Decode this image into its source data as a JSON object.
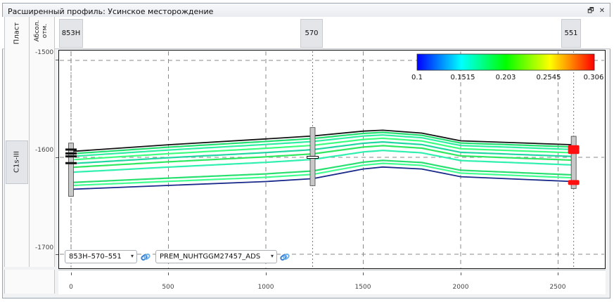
{
  "window": {
    "title": "Расширенный профиль: Усинское месторождение",
    "restore_icon": "restore-window-icon",
    "close_icon": "close-icon",
    "restore_glyph": "🗗",
    "close_glyph": "✕"
  },
  "columns": {
    "plast": "Пласт",
    "abs_line1": "Абсол.",
    "abs_line2": "отм."
  },
  "wells": [
    {
      "name": "853Н"
    },
    {
      "name": "570"
    },
    {
      "name": "551"
    }
  ],
  "layer": {
    "name": "C1s-III"
  },
  "y_axis": {
    "ticks": [
      "-1500",
      "-1600",
      "-1700"
    ]
  },
  "x_axis": {
    "ticks": [
      "0",
      "500",
      "1000",
      "1500",
      "2000",
      "2500"
    ]
  },
  "legend": {
    "labels": [
      "0.1",
      "0.1515",
      "0.203",
      "0.2545",
      "0.306"
    ],
    "colors": [
      "#0000ff",
      "#00ffff",
      "#00ff00",
      "#ffff00",
      "#ff0000"
    ]
  },
  "controls": {
    "profile_select": "853Н–570–551",
    "property_select": "PREM_NUHTGGM27457_ADS",
    "link_icon": "link-icon"
  },
  "chart_data": {
    "type": "line",
    "x_units": "m",
    "xlim": [
      0,
      2750
    ],
    "ylim": [
      -1700,
      -1500
    ],
    "well_positions": [
      {
        "name": "853Н",
        "x": 0
      },
      {
        "name": "570",
        "x": 1240
      },
      {
        "name": "551",
        "x": 2580
      }
    ],
    "series": [
      {
        "color": "#111111",
        "x": [
          0,
          500,
          1000,
          1240,
          1500,
          1600,
          1800,
          2000,
          2580
        ],
        "y": [
          -1594,
          -1587,
          -1581,
          -1578,
          -1573,
          -1572,
          -1575,
          -1583,
          -1587
        ]
      },
      {
        "color": "#1a2a8a",
        "x": [
          0,
          500,
          1000,
          1240,
          1500,
          1600,
          1800,
          2000,
          2580
        ],
        "y": [
          -1633,
          -1629,
          -1625,
          -1622,
          -1612,
          -1610,
          -1612,
          -1620,
          -1625
        ]
      }
    ]
  }
}
